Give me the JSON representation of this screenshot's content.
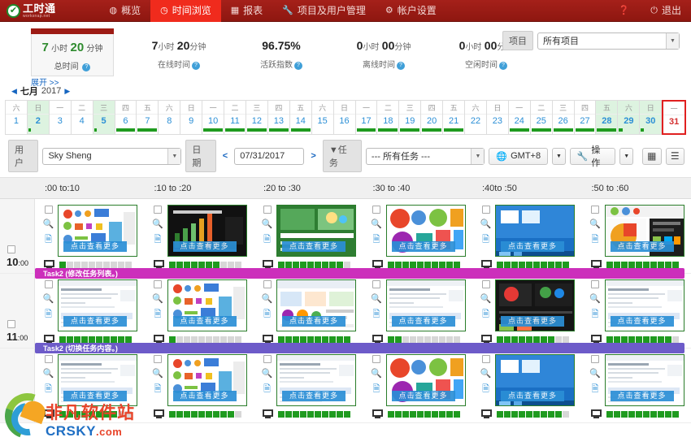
{
  "nav": {
    "logo_cn": "工时通",
    "logo_sub": "worksnap.net",
    "logo_icon": "check-circle-icon",
    "items": [
      {
        "label": "概览",
        "icon": "dashboard-icon",
        "active": false
      },
      {
        "label": "时间浏览",
        "icon": "clock-icon",
        "active": true
      },
      {
        "label": "报表",
        "icon": "report-icon",
        "active": false
      },
      {
        "label": "项目及用户管理",
        "icon": "wrench-icon",
        "active": false
      },
      {
        "label": "帐户设置",
        "icon": "gear-icon",
        "active": false
      }
    ],
    "help_icon": "help-icon",
    "logout_label": "退出",
    "logout_icon": "power-icon"
  },
  "stats": {
    "total": {
      "hours": "7",
      "hours_unit": "小时",
      "minutes": "20",
      "minutes_unit": "分钟",
      "label": "总时间"
    },
    "items": [
      {
        "num": "7",
        "unit": "小时",
        "num2": "20",
        "unit2": "分钟",
        "label": "在线时间"
      },
      {
        "num": "96.75%",
        "unit": "",
        "num2": "",
        "unit2": "",
        "label": "活跃指数"
      },
      {
        "num": "0",
        "unit": "小时",
        "num2": "00",
        "unit2": "分钟",
        "label": "离线时间"
      },
      {
        "num": "0",
        "unit": "小时",
        "num2": "00",
        "unit2": "分钟",
        "label": "空闲时间"
      }
    ],
    "expand_label": "展开 >>",
    "project_label": "项目",
    "project_value": "所有项目"
  },
  "calendar": {
    "prev_icon": "caret-left-icon",
    "next_icon": "caret-right-icon",
    "month": "七月",
    "year": "2017",
    "days": [
      {
        "dow": "六",
        "num": "1",
        "weekend": false,
        "fill": 0,
        "selected": false
      },
      {
        "dow": "日",
        "num": "2",
        "weekend": true,
        "fill": 14,
        "selected": false
      },
      {
        "dow": "一",
        "num": "3",
        "weekend": false,
        "fill": 0,
        "selected": false
      },
      {
        "dow": "二",
        "num": "4",
        "weekend": false,
        "fill": 0,
        "selected": false
      },
      {
        "dow": "三",
        "num": "5",
        "weekend": true,
        "fill": 14,
        "selected": false
      },
      {
        "dow": "四",
        "num": "6",
        "weekend": false,
        "fill": 100,
        "selected": false
      },
      {
        "dow": "五",
        "num": "7",
        "weekend": false,
        "fill": 100,
        "selected": false
      },
      {
        "dow": "六",
        "num": "8",
        "weekend": false,
        "fill": 0,
        "selected": false
      },
      {
        "dow": "日",
        "num": "9",
        "weekend": false,
        "fill": 0,
        "selected": false
      },
      {
        "dow": "一",
        "num": "10",
        "weekend": false,
        "fill": 100,
        "selected": false
      },
      {
        "dow": "二",
        "num": "11",
        "weekend": false,
        "fill": 100,
        "selected": false
      },
      {
        "dow": "三",
        "num": "12",
        "weekend": false,
        "fill": 100,
        "selected": false
      },
      {
        "dow": "四",
        "num": "13",
        "weekend": false,
        "fill": 100,
        "selected": false
      },
      {
        "dow": "五",
        "num": "14",
        "weekend": false,
        "fill": 100,
        "selected": false
      },
      {
        "dow": "六",
        "num": "15",
        "weekend": false,
        "fill": 0,
        "selected": false
      },
      {
        "dow": "日",
        "num": "16",
        "weekend": false,
        "fill": 0,
        "selected": false
      },
      {
        "dow": "一",
        "num": "17",
        "weekend": false,
        "fill": 100,
        "selected": false
      },
      {
        "dow": "二",
        "num": "18",
        "weekend": false,
        "fill": 100,
        "selected": false
      },
      {
        "dow": "三",
        "num": "19",
        "weekend": false,
        "fill": 100,
        "selected": false
      },
      {
        "dow": "四",
        "num": "20",
        "weekend": false,
        "fill": 100,
        "selected": false
      },
      {
        "dow": "五",
        "num": "21",
        "weekend": false,
        "fill": 100,
        "selected": false
      },
      {
        "dow": "六",
        "num": "22",
        "weekend": false,
        "fill": 0,
        "selected": false
      },
      {
        "dow": "日",
        "num": "23",
        "weekend": false,
        "fill": 0,
        "selected": false
      },
      {
        "dow": "一",
        "num": "24",
        "weekend": false,
        "fill": 100,
        "selected": false
      },
      {
        "dow": "二",
        "num": "25",
        "weekend": false,
        "fill": 100,
        "selected": false
      },
      {
        "dow": "三",
        "num": "26",
        "weekend": false,
        "fill": 100,
        "selected": false
      },
      {
        "dow": "四",
        "num": "27",
        "weekend": false,
        "fill": 100,
        "selected": false
      },
      {
        "dow": "五",
        "num": "28",
        "weekend": true,
        "fill": 100,
        "selected": false
      },
      {
        "dow": "六",
        "num": "29",
        "weekend": true,
        "fill": 20,
        "selected": false
      },
      {
        "dow": "日",
        "num": "30",
        "weekend": true,
        "fill": 14,
        "selected": false
      },
      {
        "dow": "一",
        "num": "31",
        "weekend": false,
        "fill": 0,
        "selected": true
      }
    ]
  },
  "toolbar": {
    "user_label": "用户",
    "user_value": "Sky Sheng",
    "date_label": "日期",
    "date_prev_icon": "chevron-left-icon",
    "date_next_icon": "chevron-right-icon",
    "date_value": "07/31/2017",
    "task_label": "任务",
    "task_filter_icon": "filter-icon",
    "task_value": "--- 所有任务 ---",
    "timezone_label": "GMT+8",
    "timezone_icon": "globe-icon",
    "action_label": "操作",
    "action_icon": "wrench-icon",
    "caret_icon": "caret-down-icon",
    "grid_view_icon": "grid-view-icon",
    "list_view_icon": "list-view-icon"
  },
  "grid": {
    "columns": [
      ":00 to:10",
      ":10 to :20",
      ":20 to :30",
      ":30 to :40",
      ":40to :50",
      ":50 to :60"
    ],
    "thumb_overlay": "点击查看更多",
    "zoom_icon": "magnifier-icon",
    "doc_icon": "document-icon",
    "monitor_icon": "monitor-icon",
    "rows": [
      {
        "hour": "10",
        "minute": ":00",
        "cells": [
          {
            "activity": 1,
            "art": "charts-white"
          },
          {
            "activity": 7,
            "art": "dark-chart"
          },
          {
            "activity": 9,
            "art": "green-slide"
          },
          {
            "activity": 10,
            "art": "pie-report"
          },
          {
            "activity": 10,
            "art": "blue-desktop"
          },
          {
            "activity": 10,
            "art": "pie-dark"
          }
        ],
        "taskbar": {
          "text": "Task2 (修改任务列表。)",
          "color": "#cc2fbb"
        }
      },
      {
        "hour": "11",
        "minute": ":00",
        "cells": [
          {
            "activity": 10,
            "art": "doc-form"
          },
          {
            "activity": 1,
            "art": "charts-white"
          },
          {
            "activity": 10,
            "art": "slide-grid"
          },
          {
            "activity": 2,
            "art": "doc-form"
          },
          {
            "activity": 8,
            "art": "dark-media"
          },
          {
            "activity": 9,
            "art": "doc-form"
          }
        ],
        "taskbar": {
          "text": "Task2 (切换任务内容。)",
          "color": "#6d5bc9"
        }
      },
      {
        "hour": "",
        "minute": "",
        "cells": [
          {
            "activity": 8,
            "art": "doc-form"
          },
          {
            "activity": 9,
            "art": "charts-white"
          },
          {
            "activity": 10,
            "art": "doc-form"
          },
          {
            "activity": 10,
            "art": "pie-report"
          },
          {
            "activity": 9,
            "art": "blue-desktop"
          },
          {
            "activity": 10,
            "art": "doc-form"
          }
        ],
        "taskbar": null
      }
    ]
  },
  "watermark": {
    "cn": "非凡软件站",
    "en": "CRSKY",
    "suffix": ".com"
  },
  "colors": {
    "brand_red": "#9d1b14",
    "active_red": "#f02b1d",
    "activity_green": "#1f9b1f",
    "link_blue": "#2b8fd6",
    "task_magenta": "#cc2fbb",
    "task_purple": "#6d5bc9"
  }
}
